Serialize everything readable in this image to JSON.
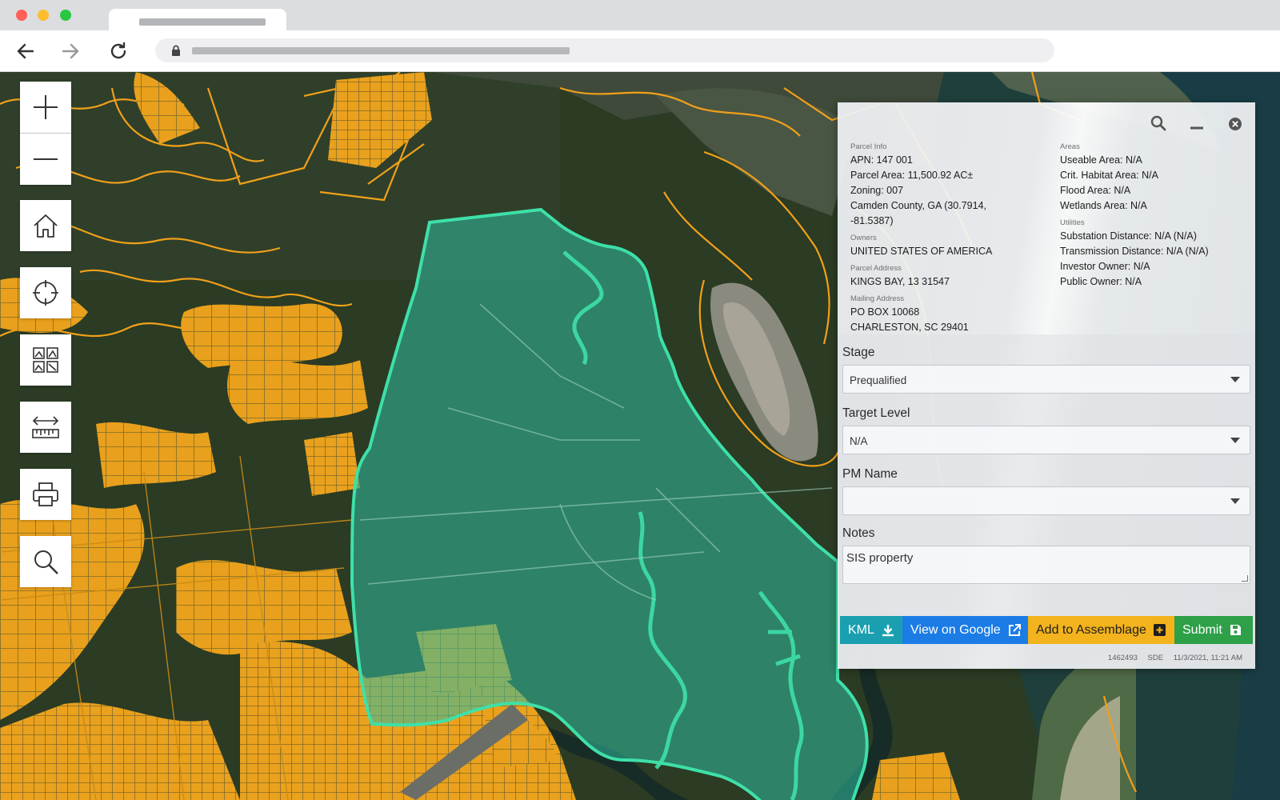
{
  "browser": {
    "tab_title": "",
    "url": "",
    "back_icon": "arrow-left-icon",
    "forward_icon": "arrow-right-icon",
    "reload_icon": "reload-icon",
    "lock_icon": "lock-icon"
  },
  "map": {
    "parcel_color": "#f0a01a",
    "selected_fill": "#2fb69a",
    "selected_outline": "#3ee0a8",
    "tools": [
      {
        "name": "zoom-in",
        "icon": "plus-icon"
      },
      {
        "name": "zoom-out",
        "icon": "minus-icon"
      },
      {
        "name": "home",
        "icon": "home-icon"
      },
      {
        "name": "locate",
        "icon": "crosshair-icon"
      },
      {
        "name": "basemap-gallery",
        "icon": "gallery-icon"
      },
      {
        "name": "measure",
        "icon": "ruler-icon"
      },
      {
        "name": "print",
        "icon": "printer-icon"
      },
      {
        "name": "search",
        "icon": "search-icon"
      }
    ]
  },
  "panel": {
    "icons": [
      "search-icon",
      "minimize-icon",
      "close-icon"
    ],
    "parcel_info": {
      "label": "Parcel Info",
      "apn": "APN: 147 001",
      "area": "Parcel Area: 11,500.92 AC±",
      "zoning": "Zoning: 007",
      "county_line1": "Camden County, GA (30.7914,",
      "county_line2": "-81.5387)"
    },
    "owners": {
      "label": "Owners",
      "value": "UNITED STATES OF AMERICA"
    },
    "parcel_address": {
      "label": "Parcel Address",
      "value": "KINGS BAY, 13 31547"
    },
    "mailing_address": {
      "label": "Mailing Address",
      "line1": "PO BOX 10068",
      "line2": "CHARLESTON, SC 29401"
    },
    "areas": {
      "label": "Areas",
      "useable": "Useable Area: N/A",
      "habitat": "Crit. Habitat Area: N/A",
      "flood": "Flood Area: N/A",
      "wetlands": "Wetlands Area: N/A"
    },
    "utilities": {
      "label": "Utilities",
      "substation": "Substation Distance: N/A (N/A)",
      "transmission": "Transmission Distance: N/A (N/A)",
      "investor": "Investor Owner: N/A",
      "public": "Public Owner: N/A"
    },
    "form": {
      "stage_label": "Stage",
      "stage_value": "Prequalified",
      "target_label": "Target Level",
      "target_value": "N/A",
      "pm_label": "PM Name",
      "pm_value": "",
      "notes_label": "Notes",
      "notes_value": "SIS property"
    },
    "actions": {
      "kml": "KML",
      "google": "View on Google",
      "assemblage": "Add to Assemblage",
      "submit": "Submit",
      "colors": {
        "kml": "#1a9fb0",
        "google": "#1b7ce6",
        "assemblage": "#f3b31d",
        "submit": "#2da048"
      }
    },
    "footer": {
      "id": "1462493",
      "user": "SDE",
      "timestamp": "11/3/2021, 11:21 AM"
    }
  }
}
